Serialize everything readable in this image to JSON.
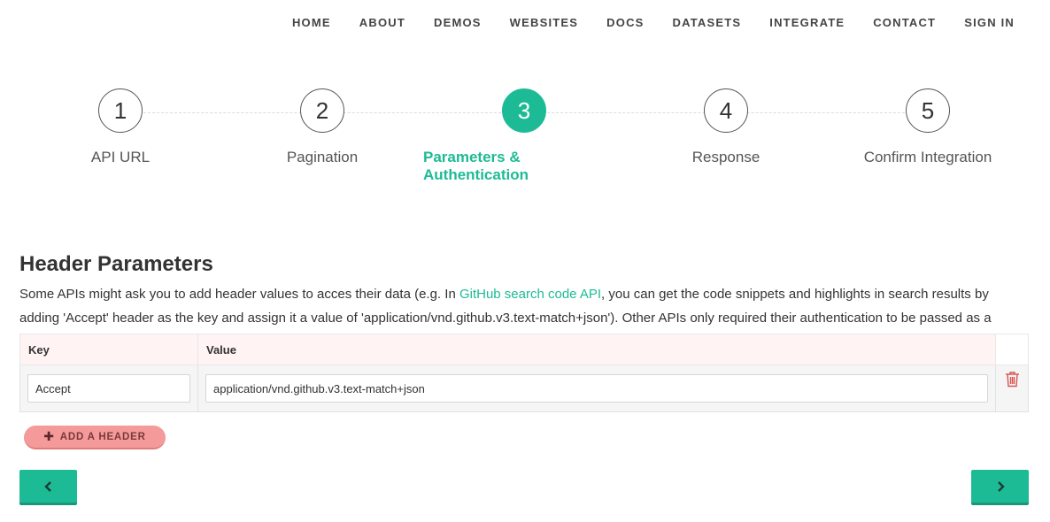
{
  "nav": {
    "items": [
      "HOME",
      "ABOUT",
      "DEMOS",
      "WEBSITES",
      "DOCS",
      "DATASETS",
      "INTEGRATE",
      "CONTACT",
      "SIGN IN"
    ]
  },
  "steps": [
    {
      "number": "1",
      "label": "API URL"
    },
    {
      "number": "2",
      "label": "Pagination"
    },
    {
      "number": "3",
      "label": "Parameters & Authentication",
      "active": true
    },
    {
      "number": "4",
      "label": "Response"
    },
    {
      "number": "5",
      "label": "Confirm Integration"
    }
  ],
  "section": {
    "title": "Header Parameters",
    "desc_before": "Some APIs might ask you to add header values to acces their data (e.g. In ",
    "desc_link": "GitHub search code API",
    "desc_after": ", you can get the code snippets and highlights in search results by adding 'Accept' header as the key and assign it a value of 'application/vnd.github.v3.text-match+json'). Other APIs only required their authentication to be passed as a header parameter."
  },
  "table": {
    "headers": {
      "key": "Key",
      "value": "Value"
    },
    "rows": [
      {
        "key": "Accept",
        "value": "application/vnd.github.v3.text-match+json"
      }
    ]
  },
  "buttons": {
    "add_header": "ADD A HEADER",
    "prev_icon": "chevron-left-icon",
    "next_icon": "chevron-right-icon"
  },
  "colors": {
    "accent": "#1dbb95",
    "add_button": "#f59a9a",
    "trash": "#d9534f",
    "header_bg": "#fff3f3"
  }
}
